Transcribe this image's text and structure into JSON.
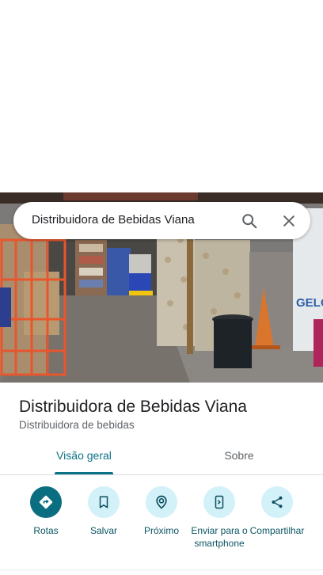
{
  "search": {
    "query": "Distribuidora de Bebidas Viana",
    "search_icon": "search-icon",
    "close_icon": "close-icon"
  },
  "photo": {
    "sign_text": "GELO"
  },
  "place": {
    "name": "Distribuidora de Bebidas Viana",
    "category": "Distribuidora de bebidas"
  },
  "tabs": [
    {
      "label": "Visão geral",
      "selected": true
    },
    {
      "label": "Sobre",
      "selected": false
    }
  ],
  "actions": [
    {
      "label": "Rotas",
      "icon": "directions-icon"
    },
    {
      "label": "Salvar",
      "icon": "bookmark-icon"
    },
    {
      "label": "Próximo",
      "icon": "nearby-icon"
    },
    {
      "label": "Enviar para o smartphone",
      "icon": "send-to-phone-icon"
    },
    {
      "label": "Compartilhar",
      "icon": "share-icon"
    }
  ],
  "colors": {
    "accent": "#0b7285",
    "action_bg": "#d3f1f8",
    "primary_action_bg": "#0b6e80"
  }
}
